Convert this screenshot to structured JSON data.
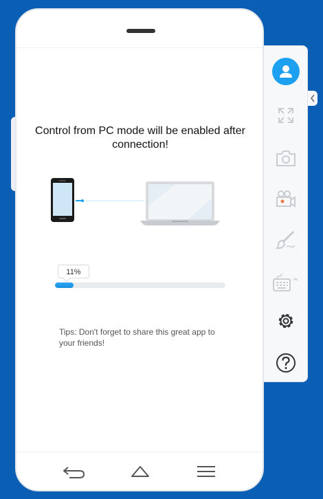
{
  "device": {
    "message": "Control from PC mode will be enabled after connection!",
    "progress": {
      "percent_label": "11%",
      "value": 0.11
    },
    "tips": "Tips: Don't forget to share this great app to your friends!"
  },
  "toolbar": {
    "items": [
      {
        "icon": "user-icon",
        "state": "active"
      },
      {
        "icon": "fullscreen-icon",
        "state": "disabled"
      },
      {
        "icon": "camera-icon",
        "state": "disabled"
      },
      {
        "icon": "video-record-icon",
        "state": "disabled"
      },
      {
        "icon": "brush-icon",
        "state": "disabled"
      },
      {
        "icon": "keyboard-icon",
        "state": "disabled"
      },
      {
        "icon": "gear-icon",
        "state": "enabled"
      },
      {
        "icon": "help-icon",
        "state": "enabled"
      }
    ]
  },
  "navbar": {
    "items": [
      {
        "icon": "back-icon"
      },
      {
        "icon": "home-icon"
      },
      {
        "icon": "menu-icon"
      }
    ]
  },
  "colors": {
    "background": "#0a5fb4",
    "accent": "#1ea0f0",
    "disabled_icon": "#c9cdd2",
    "enabled_icon": "#333333"
  }
}
